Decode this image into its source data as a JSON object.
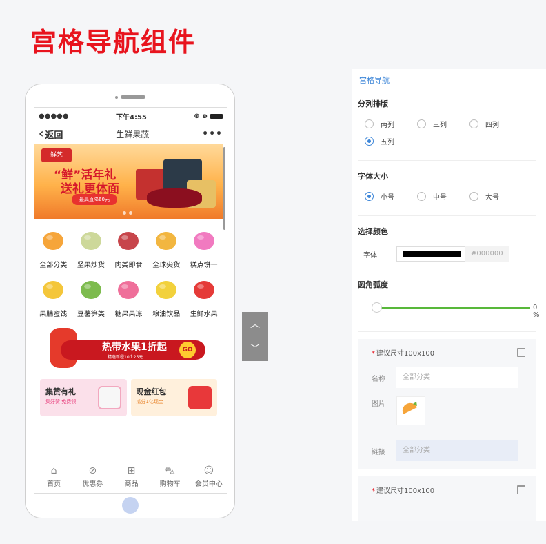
{
  "page_title": "宫格导航组件",
  "phone": {
    "status": {
      "signal": "●●●●●",
      "time": "下午4:55"
    },
    "nav": {
      "back_label": "返回",
      "title": "生鲜果蔬",
      "more": "•••"
    },
    "banner": {
      "logo": "鲜艺",
      "line1": "“鲜”活年礼",
      "line2": "送礼更体面",
      "tag": "最高直降60元"
    },
    "grid_items": [
      {
        "label": "全部分类",
        "icon": "orange-slice-icon",
        "color": "#f6a53a"
      },
      {
        "label": "坚果炒货",
        "icon": "pistachio-icon",
        "color": "#cdd89a"
      },
      {
        "label": "肉类即食",
        "icon": "steak-icon",
        "color": "#c7454b"
      },
      {
        "label": "全球尖货",
        "icon": "hot-air-balloon-icon",
        "color": "#f2b640"
      },
      {
        "label": "糕点饼干",
        "icon": "donut-icon",
        "color": "#f17ac0"
      },
      {
        "label": "果脯蜜饯",
        "icon": "mango-icon",
        "color": "#f4c63a"
      },
      {
        "label": "豆薯笋类",
        "icon": "peas-icon",
        "color": "#7dbb4e"
      },
      {
        "label": "糖果果冻",
        "icon": "lollipop-icon",
        "color": "#ef6f9a"
      },
      {
        "label": "粮油饮品",
        "icon": "oil-bottle-icon",
        "color": "#f2d13c"
      },
      {
        "label": "生鲜水果",
        "icon": "strawberry-icon",
        "color": "#e53a38"
      }
    ],
    "promo": {
      "title": "热带水果1折起",
      "sub": "精选新橙10个25元",
      "go": "GO"
    },
    "cards": [
      {
        "title": "集赞有礼",
        "sub": "集好赞 免费领"
      },
      {
        "title": "现金红包",
        "sub": "瓜分1亿现金"
      }
    ],
    "tabs": [
      {
        "label": "首页",
        "icon": "home-icon",
        "glyph": "⌂"
      },
      {
        "label": "优惠券",
        "icon": "coupon-icon",
        "glyph": "⊘"
      },
      {
        "label": "商品",
        "icon": "grid-icon",
        "glyph": "⊞"
      },
      {
        "label": "购物车",
        "icon": "cart-icon",
        "glyph": "⛍"
      },
      {
        "label": "会员中心",
        "icon": "member-icon",
        "glyph": "☺"
      }
    ]
  },
  "arrows": {
    "up": "︿",
    "down": "﹀"
  },
  "panel": {
    "tab": "宫格导航",
    "layout_section": {
      "title": "分列排版",
      "options": [
        "两列",
        "三列",
        "四列",
        "五列"
      ],
      "selected": "五列"
    },
    "font_section": {
      "title": "字体大小",
      "options": [
        "小号",
        "中号",
        "大号"
      ],
      "selected": "小号"
    },
    "color_section": {
      "title": "选择颜色",
      "label": "字体",
      "hex": "#000000",
      "color": "#000000"
    },
    "radius_section": {
      "title": "圆角弧度",
      "value": "0 %"
    },
    "items": [
      {
        "hint": "建议尺寸100x100",
        "name_label": "名称",
        "name_placeholder": "全部分类",
        "image_label": "图片",
        "link_label": "链接",
        "link_value": "全部分类"
      },
      {
        "hint": "建议尺寸100x100"
      }
    ]
  }
}
